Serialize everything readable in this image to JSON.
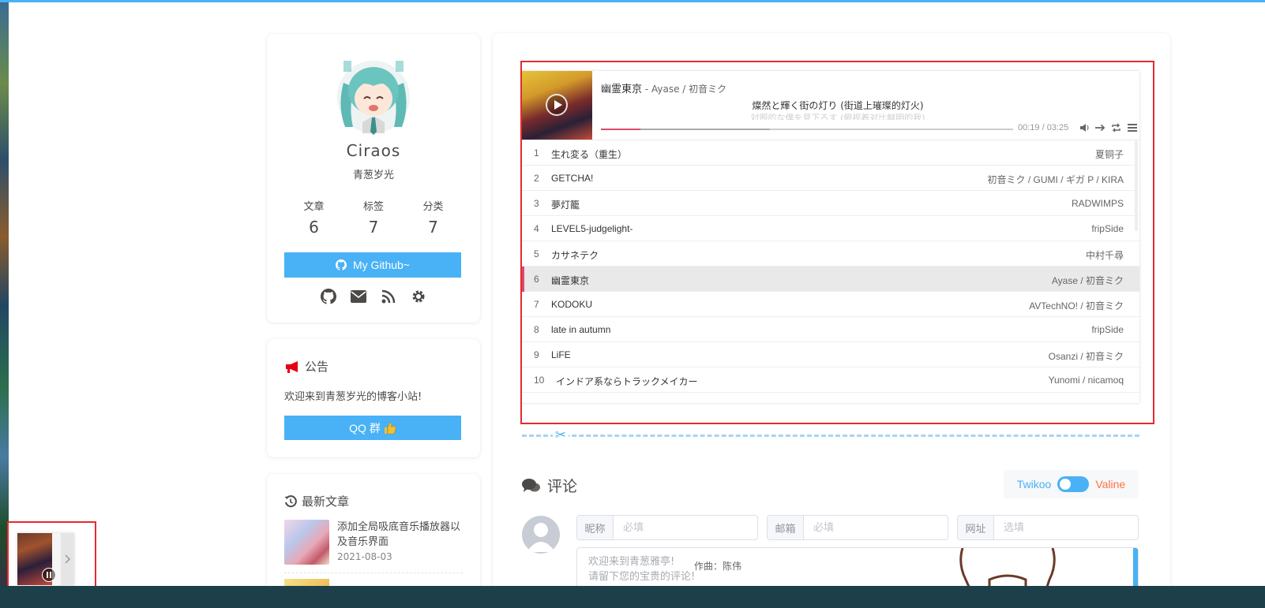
{
  "author": {
    "name": "Ciraos",
    "desc": "青葱岁光",
    "stats": [
      {
        "label": "文章",
        "value": "6"
      },
      {
        "label": "标签",
        "value": "7"
      },
      {
        "label": "分类",
        "value": "7"
      }
    ],
    "github_button": "My Github~"
  },
  "announcement": {
    "title": "公告",
    "text": "欢迎来到青葱岁光的博客小站!",
    "qq_button": "QQ 群"
  },
  "recent": {
    "title": "最新文章",
    "items": [
      {
        "title": "添加全局吸底音乐播放器以及音乐界面",
        "date": "2021-08-03"
      }
    ]
  },
  "player": {
    "current_title": "幽霊東京",
    "current_author": " - Ayase / 初音ミク",
    "lyric_line": "燦然と輝く街の灯り (街道上璀璨的灯火)",
    "lyric_next": "対照的な僕を見下ろす (俯视着对比鲜明的我)",
    "time": "00:19 / 03:25",
    "progress_played": 0.095,
    "progress_loaded": 0.41,
    "tracks": [
      {
        "index": "1",
        "title": "生れ変る（重生）",
        "artist": "夏铜子"
      },
      {
        "index": "2",
        "title": "GETCHA!",
        "artist": "初音ミク / GUMI / ギガ P / KIRA"
      },
      {
        "index": "3",
        "title": "夢灯籠",
        "artist": "RADWIMPS"
      },
      {
        "index": "4",
        "title": "LEVEL5-judgelight-",
        "artist": "fripSide"
      },
      {
        "index": "5",
        "title": "カサネテク",
        "artist": "中村千尋"
      },
      {
        "index": "6",
        "title": "幽霊東京",
        "artist": "Ayase / 初音ミク"
      },
      {
        "index": "7",
        "title": "KODOKU",
        "artist": "AVTechNO! / 初音ミク"
      },
      {
        "index": "8",
        "title": "late in autumn",
        "artist": "fripSide"
      },
      {
        "index": "9",
        "title": "LiFE",
        "artist": "Osanzi / 初音ミク"
      },
      {
        "index": "10",
        "title": "インドア系ならトラックメイカー",
        "artist": "Yunomi / nicamoq"
      }
    ]
  },
  "comments": {
    "title": "评论",
    "switch_left": "Twikoo",
    "switch_right": "Valine",
    "fields": [
      {
        "label": "昵称",
        "placeholder": "必填"
      },
      {
        "label": "邮箱",
        "placeholder": "必填"
      },
      {
        "label": "网址",
        "placeholder": "选填"
      }
    ],
    "textarea_line1": "欢迎来到青葱雅亭!",
    "textarea_line2": "请留下您的宝贵的评论!",
    "overlay_line2": "作曲：陈伟"
  },
  "colors": {
    "accent": "#49b1f5",
    "highlight_box": "#e32b2f",
    "valine": "#ff7242"
  }
}
